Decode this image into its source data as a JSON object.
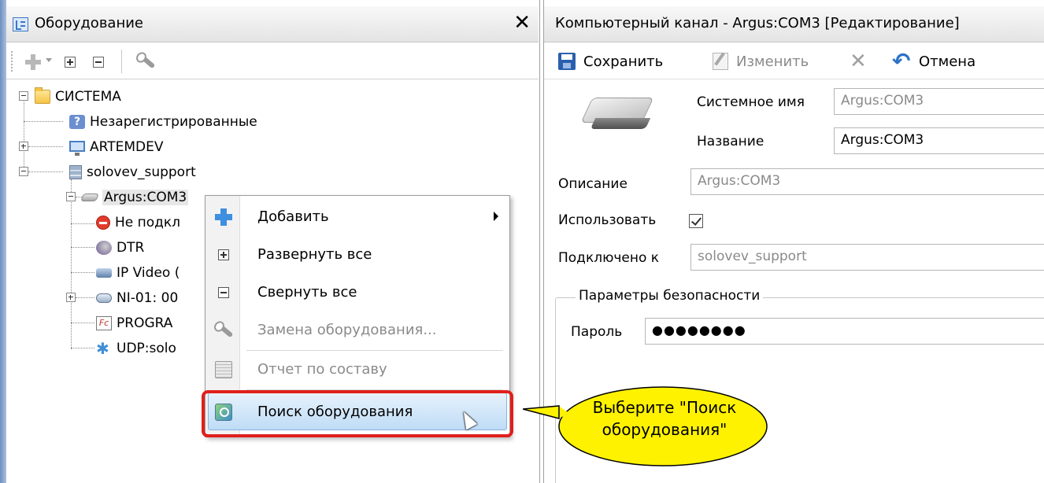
{
  "left_panel": {
    "title": "Оборудование",
    "close_glyph": "✕",
    "tree": {
      "root": "СИСТЕМА",
      "unregistered": "Незарегистрированные",
      "artemdev": "ARTEMDEV",
      "server": "solovev_support",
      "argus": "Argus:COM3",
      "not_connected": "Не подкл",
      "dtr": "DTR",
      "ipvideo": "IP Video (",
      "ni01": "NI-01: 00",
      "progra": "PROGRA",
      "udp": "UDP:solo"
    }
  },
  "right_panel": {
    "title": "Компьютерный канал - Argus:COM3 [Редактирование]",
    "toolbar": {
      "save": "Сохранить",
      "edit": "Изменить",
      "cancel": "Отмена"
    },
    "form": {
      "system_name_label": "Системное имя",
      "system_name_value": "Argus:COM3",
      "name_label": "Название",
      "name_value": "Argus:COM3",
      "description_label": "Описание",
      "description_value": "Argus:COM3",
      "use_label": "Использовать",
      "use_checked": true,
      "connected_to_label": "Подключено к",
      "connected_to_value": "solovev_support",
      "security_group": "Параметры безопасности",
      "password_label": "Пароль",
      "password_value": "●●●●●●●●"
    }
  },
  "context_menu": {
    "add": "Добавить",
    "expand_all": "Развернуть все",
    "collapse_all": "Свернуть все",
    "replace": "Замена оборудования...",
    "report": "Отчет по составу",
    "search": "Поиск оборудования"
  },
  "callout": {
    "line1": "Выберите \"Поиск",
    "line2": "оборудования\""
  },
  "colors": {
    "highlight_outline": "#e0201c",
    "callout_fill": "#fff200",
    "menu_hover": "#bfdcf6"
  }
}
